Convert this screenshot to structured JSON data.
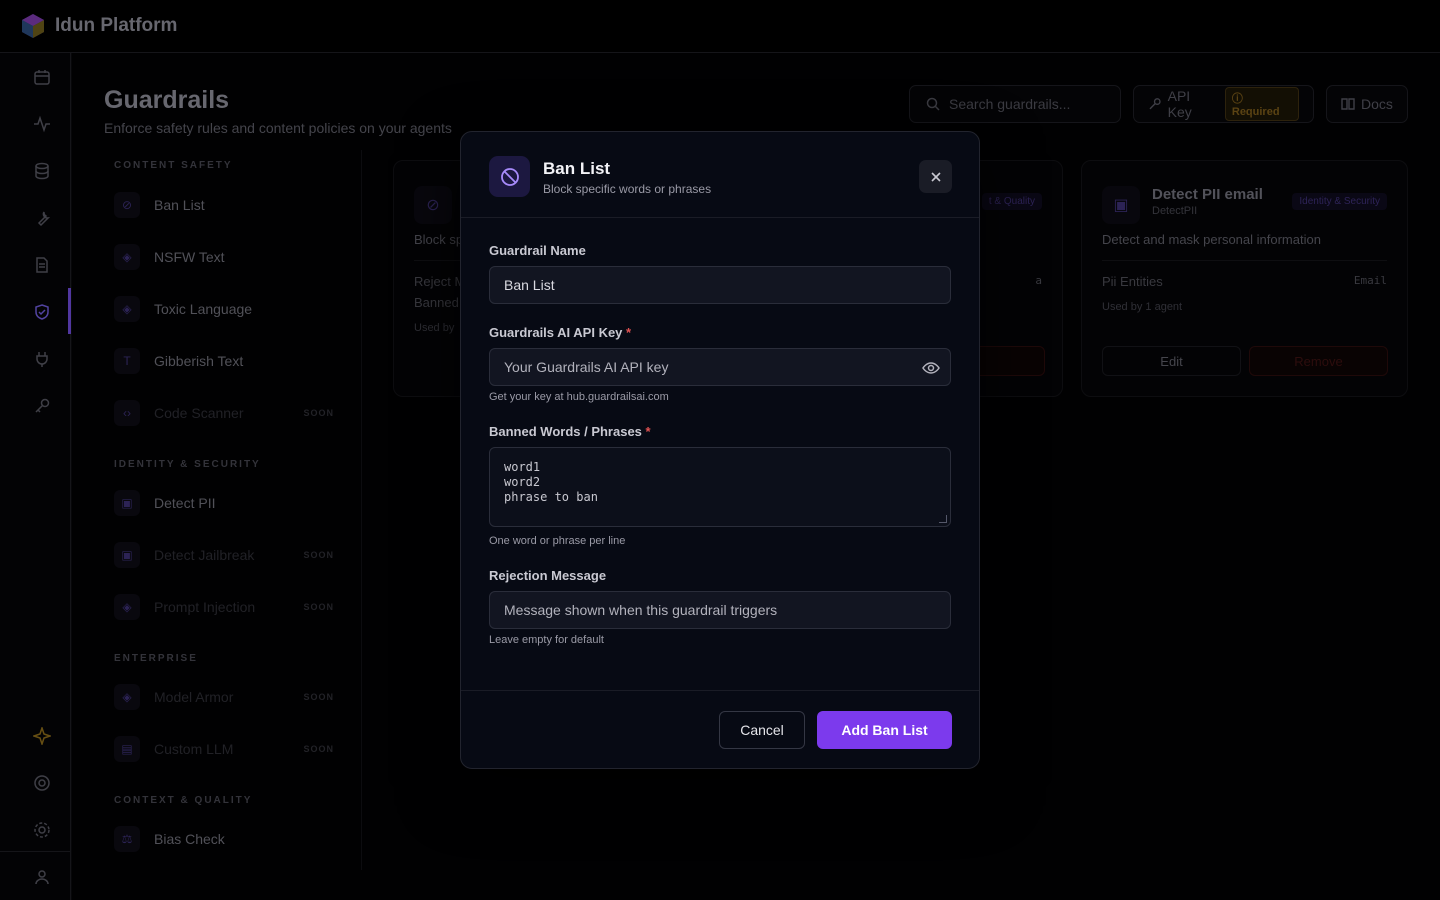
{
  "app": {
    "name": "Idun Platform"
  },
  "page": {
    "title": "Guardrails",
    "subtitle": "Enforce safety rules and content policies on your agents"
  },
  "header": {
    "search_placeholder": "Search guardrails...",
    "api_key_label": "API Key",
    "required_label": "Required",
    "docs_label": "Docs"
  },
  "sidenav": {
    "sections": [
      {
        "title": "CONTENT SAFETY"
      },
      {
        "title": "IDENTITY & SECURITY"
      },
      {
        "title": "ENTERPRISE"
      },
      {
        "title": "CONTEXT & QUALITY"
      }
    ],
    "items": [
      {
        "label": "Ban List",
        "soon": ""
      },
      {
        "label": "NSFW Text",
        "soon": ""
      },
      {
        "label": "Toxic Language",
        "soon": ""
      },
      {
        "label": "Gibberish Text",
        "soon": ""
      },
      {
        "label": "Code Scanner",
        "soon": "SOON"
      },
      {
        "label": "Detect PII",
        "soon": ""
      },
      {
        "label": "Detect Jailbreak",
        "soon": "SOON"
      },
      {
        "label": "Prompt Injection",
        "soon": "SOON"
      },
      {
        "label": "Model Armor",
        "soon": "SOON"
      },
      {
        "label": "Custom LLM",
        "soon": "SOON"
      },
      {
        "label": "Bias Check",
        "soon": ""
      }
    ]
  },
  "cards": [
    {
      "desc": "Block sp",
      "row1": "Reject M",
      "row2": "Banned",
      "used": "Used by"
    },
    {
      "badge": "t & Quality",
      "row_value": "a"
    },
    {
      "title": "Detect PII email",
      "subtitle": "DetectPII",
      "badge": "Identity & Security",
      "desc": "Detect and mask personal information",
      "row_label": "Pii Entities",
      "row_value": "Email",
      "used": "Used by 1 agent",
      "edit_label": "Edit",
      "remove_label": "Remove"
    }
  ],
  "modal": {
    "title": "Ban List",
    "subtitle": "Block specific words or phrases",
    "fields": {
      "name_label": "Guardrail Name",
      "name_value": "Ban List",
      "api_label": "Guardrails AI API Key",
      "api_placeholder": "Your Guardrails AI API key",
      "api_hint": "Get your key at hub.guardrailsai.com",
      "words_label": "Banned Words / Phrases",
      "words_placeholder": "word1\nword2\nphrase to ban",
      "words_hint": "One word or phrase per line",
      "rejection_label": "Rejection Message",
      "rejection_placeholder": "Message shown when this guardrail triggers",
      "rejection_hint": "Leave empty for default"
    },
    "required_mark": "*",
    "cancel_label": "Cancel",
    "submit_label": "Add Ban List"
  },
  "colors": {
    "accent": "#7c3aed",
    "required": "#e05252",
    "modal_bg": "#070a14"
  },
  "icons": {
    "logo": "cube-logo-icon",
    "modal": "ban-icon",
    "close": "close-icon",
    "eye": "eye-icon"
  }
}
